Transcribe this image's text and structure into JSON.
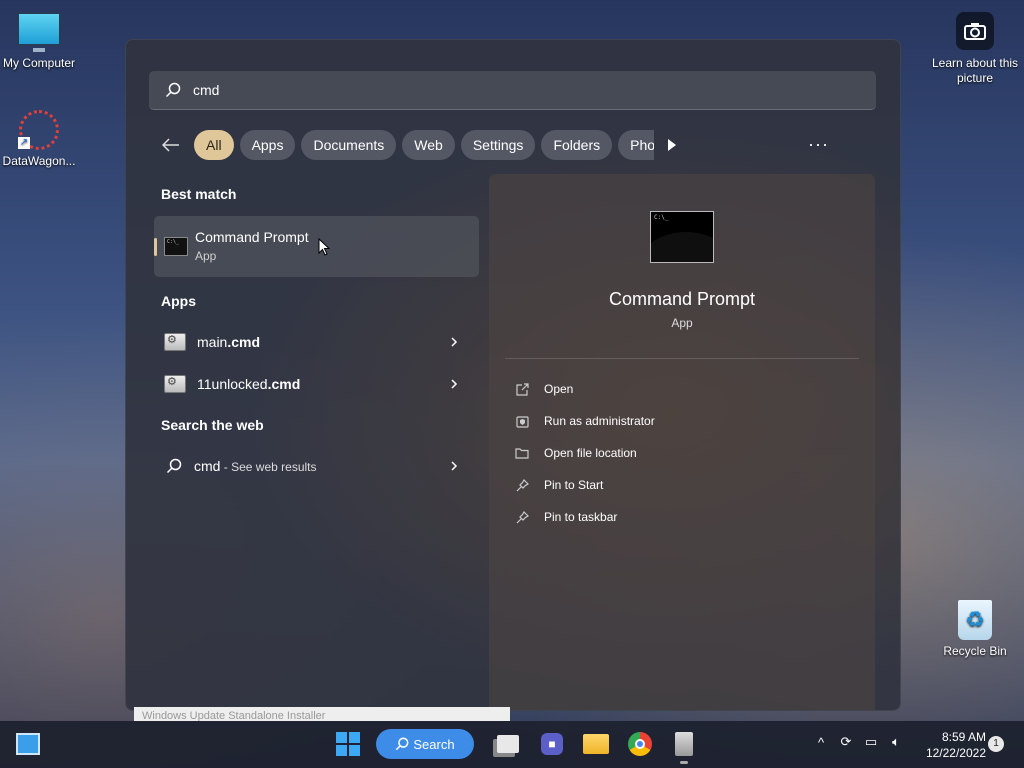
{
  "desktop": {
    "icons": [
      {
        "label": "My Computer"
      },
      {
        "label": "DataWagon..."
      },
      {
        "label": "Learn about this picture"
      },
      {
        "label": "Recycle Bin"
      }
    ]
  },
  "start": {
    "search": {
      "value": "cmd"
    },
    "filters": [
      "All",
      "Apps",
      "Documents",
      "Web",
      "Settings",
      "Folders",
      "Pho"
    ],
    "best_match": {
      "section": "Best match",
      "title": "Command Prompt",
      "subtitle": "App"
    },
    "apps": {
      "section": "Apps",
      "items": [
        {
          "name": "main",
          "ext": ".cmd"
        },
        {
          "name": "11unlocked",
          "ext": ".cmd"
        }
      ]
    },
    "web": {
      "section": "Search the web",
      "query": "cmd",
      "suffix": " - See web results"
    },
    "preview": {
      "title": "Command Prompt",
      "subtitle": "App",
      "actions": [
        "Open",
        "Run as administrator",
        "Open file location",
        "Pin to Start",
        "Pin to taskbar"
      ]
    }
  },
  "background_window": {
    "title": "Windows Update Standalone Installer"
  },
  "taskbar": {
    "search_label": "Search",
    "time": "8:59 AM",
    "date": "12/22/2022",
    "notification_count": "1"
  }
}
